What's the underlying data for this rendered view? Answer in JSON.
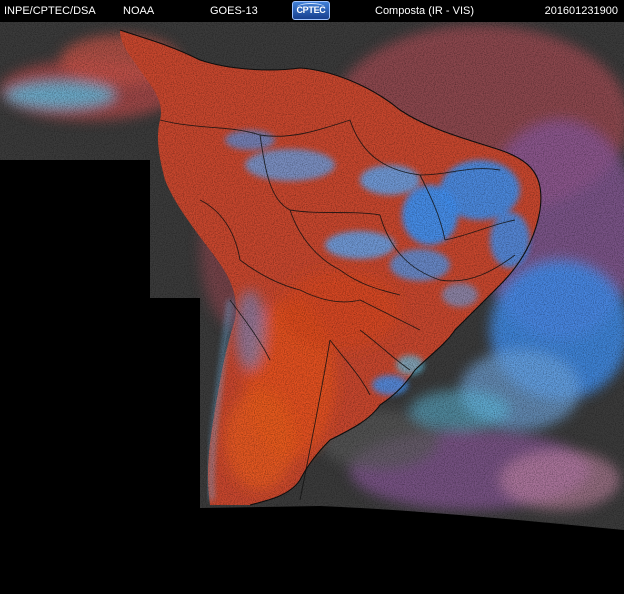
{
  "header": {
    "source": "INPE/CPTEC/DSA",
    "agency": "NOAA",
    "satellite": "GOES-13",
    "logo_text": "CPTEC",
    "product": "Composta (IR - VIS)",
    "timestamp": "201601231900"
  },
  "image": {
    "subject": "Satellite composite imagery of South America",
    "colors": {
      "background": "#000000",
      "land_warm": "#d9461f",
      "land_red": "#b94a3c",
      "cloud_blue": "#3f8ff0",
      "cloud_cyan": "#5fc3e8",
      "cloud_purple": "#8a5a9a",
      "ocean_gray": "#3b3b3b",
      "border_lines": "#111111"
    }
  }
}
